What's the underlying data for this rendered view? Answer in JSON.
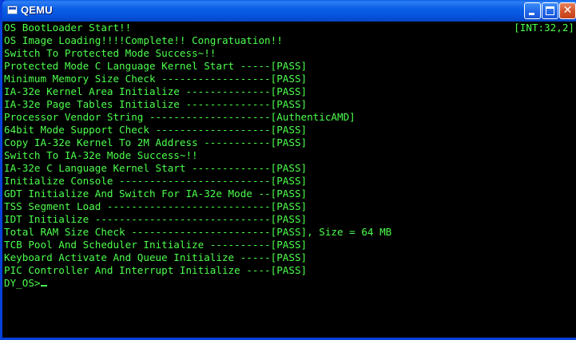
{
  "window": {
    "title": "QEMU",
    "buttons": {
      "minimize": "minimize",
      "maximize": "maximize",
      "close": "close"
    }
  },
  "console": {
    "status_indicator": "[INT:32,2]",
    "lines": [
      "OS BootLoader Start!!",
      "OS Image Loading!!!!Complete!! Congratuation!!",
      "Switch To Protected Mode Success~!!",
      "Protected Mode C Language Kernel Start -----[PASS]",
      "Minimum Memory Size Check ------------------[PASS]",
      "IA-32e Kernel Area Initialize --------------[PASS]",
      "IA-32e Page Tables Initialize --------------[PASS]",
      "Processor Vendor String --------------------[AuthenticAMD]",
      "64bit Mode Support Check -------------------[PASS]",
      "Copy IA-32e Kernel To 2M Address -----------[PASS]",
      "Switch To IA-32e Mode Success~!!",
      "IA-32e C Language Kernel Start -------------[PASS]",
      "Initialize Console -------------------------[PASS]",
      "GDT Initialize And Switch For IA-32e Mode --[PASS]",
      "TSS Segment Load ---------------------------[PASS]",
      "IDT Initialize -----------------------------[PASS]",
      "Total RAM Size Check -----------------------[PASS], Size = 64 MB",
      "TCB Pool And Scheduler Initialize ----------[PASS]",
      "Keyboard Activate And Queue Initialize -----[PASS]",
      "PIC Controller And Interrupt Initialize ----[PASS]"
    ],
    "prompt": "DY_OS>",
    "input_value": ""
  },
  "colors": {
    "text_green": "#4cff4c",
    "background": "#000000",
    "titlebar_blue": "#0a5fe8",
    "close_red": "#d5532a"
  },
  "icons": {
    "app": "qemu-window-icon",
    "minimize": "minimize-icon",
    "maximize": "maximize-icon",
    "close": "close-icon"
  }
}
